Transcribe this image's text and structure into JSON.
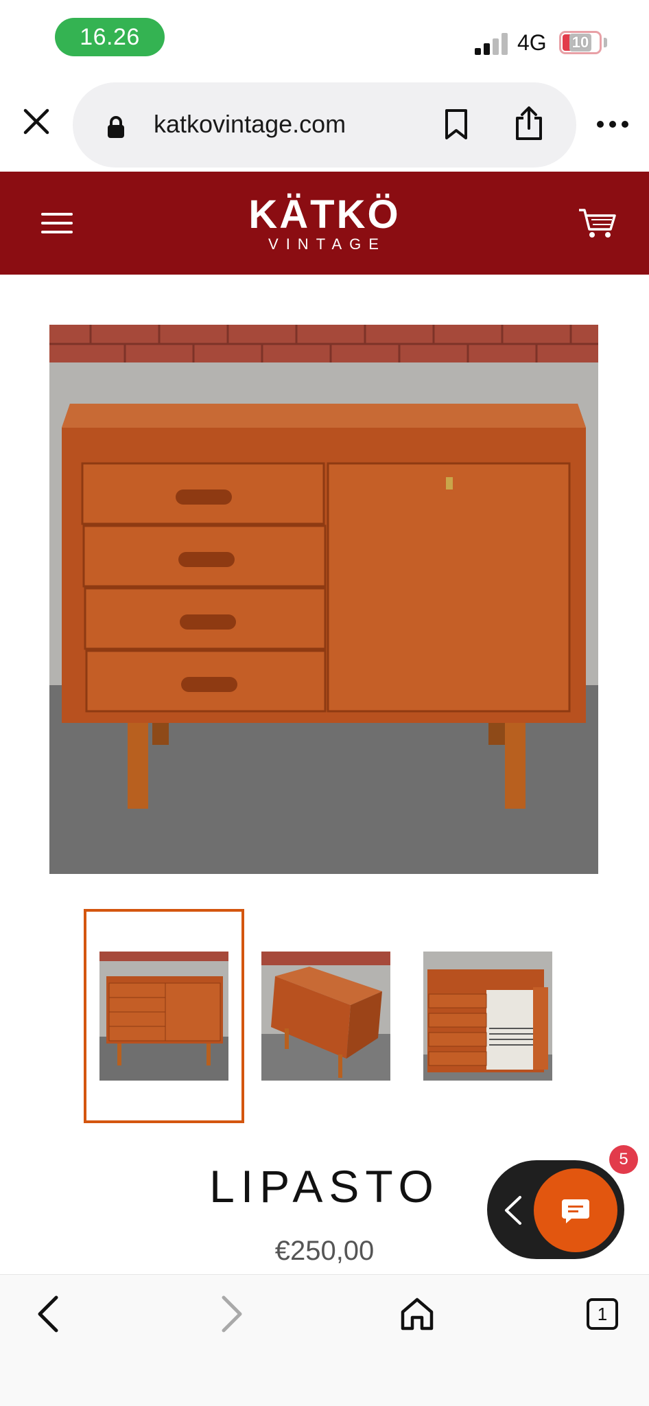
{
  "status_bar": {
    "time": "16.26",
    "network": "4G",
    "battery": "10"
  },
  "browser": {
    "url": "katkovintage.com",
    "tab_count": "1"
  },
  "site": {
    "logo_main": "KÄTKÖ",
    "logo_sub": "VINTAGE",
    "brand_color": "#8b0d12"
  },
  "product": {
    "title": "LIPASTO",
    "price": "€250,00",
    "selected_thumbnail": 1
  },
  "chat": {
    "badge_count": "5",
    "accent_color": "#e2560f"
  },
  "icons": [
    "close-icon",
    "lock-icon",
    "bookmark-icon",
    "share-icon",
    "more-icon",
    "menu-icon",
    "cart-icon",
    "chevron-left-icon",
    "chat-icon",
    "back-icon",
    "forward-icon",
    "home-icon",
    "tabs-icon"
  ]
}
